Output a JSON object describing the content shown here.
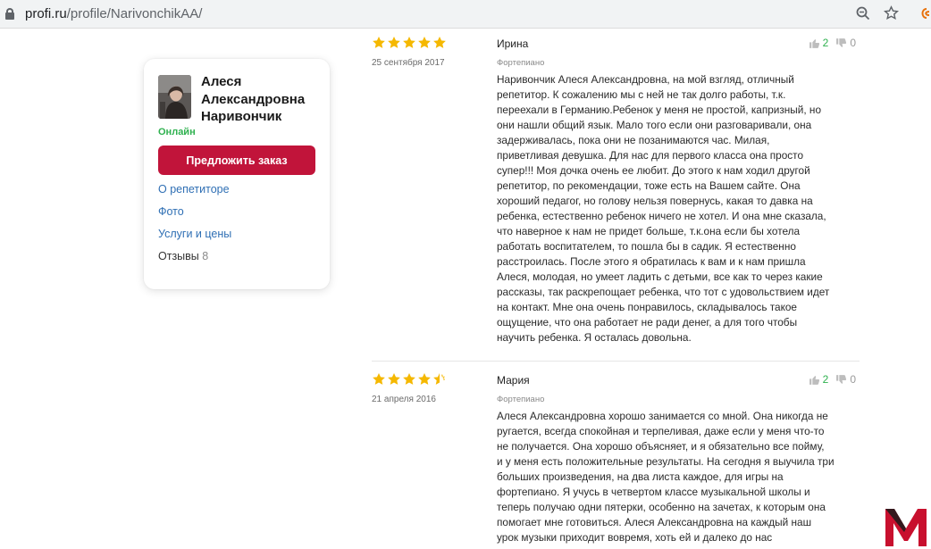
{
  "browser": {
    "url_host": "profi.ru",
    "url_path": "/profile/NarivonchikAA/"
  },
  "sidebar": {
    "name": "Алеся Александровна Наривончик",
    "status": "Онлайн",
    "offer_button": "Предложить заказ",
    "links": [
      "О репетиторе",
      "Фото",
      "Услуги и цены"
    ],
    "reviews_label": "Отзывы",
    "reviews_count": "8"
  },
  "reviews": [
    {
      "rating": 5,
      "date": "25 сентября 2017",
      "author": "Ирина",
      "subject": "Фортепиано",
      "likes": "2",
      "dislikes": "0",
      "lines": [
        "Наривончик Алеся Александровна, на мой взгляд, отличный",
        "репетитор. К сожалению мы с ней не так долго работы, т.к.",
        "переехали в Германию.Ребенок у меня не простой, капризный, но",
        "они нашли общий язык. Мало того если они разговаривали, она",
        "задерживалась, пока они не позанимаются час. Милая,",
        "приветливая девушка. Для нас для первого класса она просто",
        "супер!!! Моя дочка очень ее любит. До этого к нам ходил другой",
        "репетитор, по рекомендации, тоже есть на Вашем сайте. Она",
        "хороший педагог, но голову нельзя повернусь, какая то давка на",
        "ребенка, естественно ребенок ничего не хотел. И она мне сказала,",
        "что наверное к нам не придет больше, т.к.она если бы хотела",
        "работать воспитателем, то пошла бы в садик. Я естественно",
        "расстроилась. После этого я обратилась к вам и к нам пришла",
        "Алеся, молодая, но умеет ладить с детьми, все как то через какие",
        "рассказы, так раскрепощает ребенка, что тот с удовольствием идет",
        "на контакт. Мне она очень понравилось, складывалось такое",
        "ощущение, что она работает не ради денег, а для того чтобы",
        "научить ребенка. Я осталась довольна."
      ]
    },
    {
      "rating": 4.5,
      "date": "21 апреля 2016",
      "author": "Мария",
      "subject": "Фортепиано",
      "likes": "2",
      "dislikes": "0",
      "lines": [
        "Алеся Александровна хорошо занимается со мной. Она никогда не",
        "ругается, всегда спокойная и терпеливая, даже если у меня что-то",
        "не получается. Она хорошо объясняет, и я обязательно все пойму,",
        "и у меня есть положительные результаты. На сегодня я выучила три",
        "больших произведения, на два листа каждое, для игры на",
        "фортепиано. Я учусь в четвертом классе музыкальной школы и",
        "теперь получаю одни пятерки, особенно на зачетах, к которым она",
        "помогает мне готовиться. Алеся Александровна на каждый наш",
        "урок музыки приходит вовремя, хоть ей и далеко до нас"
      ]
    }
  ],
  "colors": {
    "star": "#f5b800",
    "brand": "#c1143a",
    "link": "#2f6fb4",
    "online": "#2fb14f"
  }
}
